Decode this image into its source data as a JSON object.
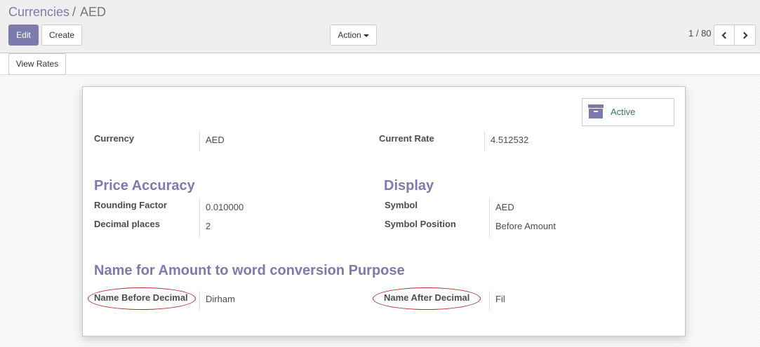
{
  "breadcrumb": {
    "parent": "Currencies",
    "separator": "/",
    "current": "AED"
  },
  "toolbar": {
    "edit_label": "Edit",
    "create_label": "Create",
    "action_label": "Action"
  },
  "pager": {
    "value": "1 / 80"
  },
  "statusbar": {
    "view_rates_label": "View Rates"
  },
  "sheet": {
    "active_label": "Active",
    "currency_label": "Currency",
    "currency_value": "AED",
    "current_rate_label": "Current Rate",
    "current_rate_value": "4.512532",
    "price_accuracy_title": "Price Accuracy",
    "rounding_factor_label": "Rounding Factor",
    "rounding_factor_value": "0.010000",
    "decimal_places_label": "Decimal places",
    "decimal_places_value": "2",
    "display_title": "Display",
    "symbol_label": "Symbol",
    "symbol_value": "AED",
    "symbol_position_label": "Symbol Position",
    "symbol_position_value": "Before Amount",
    "amount_word_title": "Name for Amount to word conversion Purpose",
    "name_before_decimal_label": "Name Before Decimal",
    "name_before_decimal_value": "Dirham",
    "name_after_decimal_label": "Name After Decimal",
    "name_after_decimal_value": "Fil"
  },
  "icons": {
    "archive": "archive-icon",
    "prev": "chevron-left-icon",
    "next": "chevron-right-icon",
    "dropdown": "caret-down-icon"
  },
  "colors": {
    "accent": "#7c7bad",
    "active_text": "#3a7a4a",
    "highlight_ellipse": "#b22a2a"
  }
}
